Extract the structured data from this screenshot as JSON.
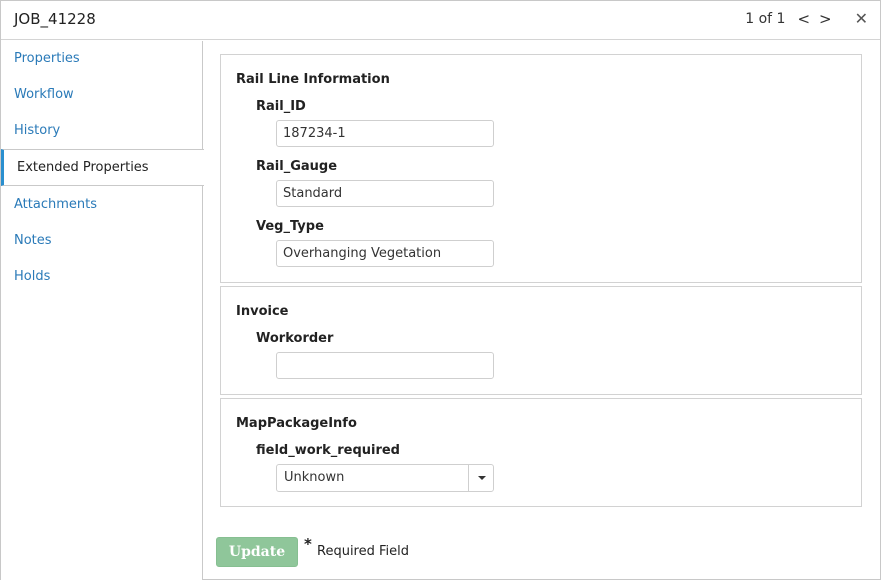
{
  "window": {
    "title": "JOB_41228",
    "pager": {
      "count": "1 of 1",
      "prev": "<",
      "next": ">",
      "close": "✕"
    }
  },
  "sidebar": {
    "items": [
      {
        "label": "Properties"
      },
      {
        "label": "Workflow"
      },
      {
        "label": "History"
      },
      {
        "label": "Extended Properties",
        "active": true
      },
      {
        "label": "Attachments"
      },
      {
        "label": "Notes"
      },
      {
        "label": "Holds"
      }
    ]
  },
  "groups": {
    "rail": {
      "title": "Rail Line Information",
      "rail_id": {
        "label": "Rail_ID",
        "value": "187234-1"
      },
      "rail_gauge": {
        "label": "Rail_Gauge",
        "value": "Standard"
      },
      "veg_type": {
        "label": "Veg_Type",
        "value": "Overhanging Vegetation"
      }
    },
    "invoice": {
      "title": "Invoice",
      "workorder": {
        "label": "Workorder",
        "value": ""
      }
    },
    "map": {
      "title": "MapPackageInfo",
      "field_work_required": {
        "label": "field_work_required",
        "value": "Unknown"
      }
    }
  },
  "footer": {
    "update_label": "Update",
    "asterisk": "*",
    "required_text": "Required Field"
  },
  "colors": {
    "link": "#2a7ab8",
    "active_indicator": "#2a8fcf",
    "update_button": "#8fc69a"
  }
}
